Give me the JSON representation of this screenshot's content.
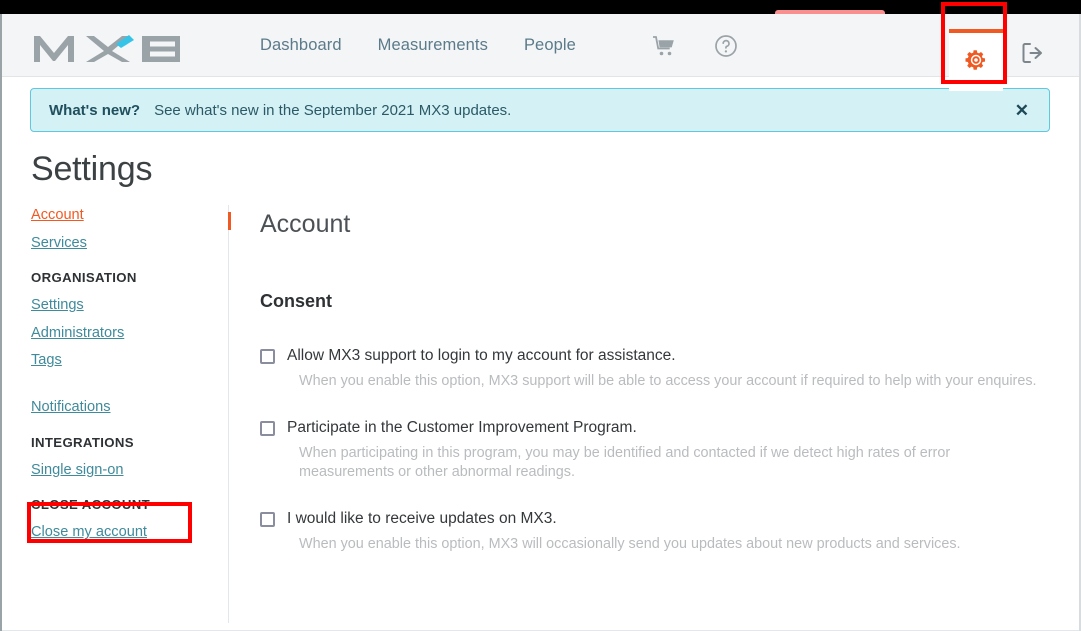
{
  "header": {
    "logo_text": "MX3",
    "logo_color": "#9aa3a8",
    "logo_accent_color": "#35c4e8",
    "nav": [
      {
        "label": "Dashboard",
        "name": "nav-dashboard"
      },
      {
        "label": "Measurements",
        "name": "nav-measurements"
      },
      {
        "label": "People",
        "name": "nav-people"
      }
    ],
    "icons": {
      "cart": "cart-icon",
      "help": "help-circle-icon",
      "settings": "gear-icon",
      "logout": "logout-icon"
    },
    "settings_active": true,
    "accent_color": "#f05a22"
  },
  "banner": {
    "strong": "What's new?",
    "text": "See what's new in the September 2021 MX3 updates.",
    "close_label": "✕",
    "background": "#d4f1f5",
    "border_color": "#5ec8dd"
  },
  "page": {
    "title": "Settings"
  },
  "sidebar": {
    "items": [
      {
        "label": "Account",
        "active": true
      },
      {
        "label": "Services",
        "active": false
      }
    ],
    "groups": [
      {
        "heading": "ORGANISATION",
        "items": [
          {
            "label": "Settings"
          },
          {
            "label": "Administrators"
          },
          {
            "label": "Tags"
          }
        ]
      }
    ],
    "notifications": {
      "label": "Notifications"
    },
    "integrations": {
      "heading": "INTEGRATIONS",
      "items": [
        {
          "label": "Single sign-on",
          "highlighted": true
        }
      ]
    },
    "close_account": {
      "heading": "CLOSE ACCOUNT",
      "items": [
        {
          "label": "Close my account"
        }
      ]
    },
    "link_color": "#3f8a9b",
    "active_color": "#f05a22"
  },
  "main": {
    "title": "Account",
    "section_title": "Consent",
    "consents": [
      {
        "label": "Allow MX3 support to login to my account for assistance.",
        "description": "When you enable this option, MX3 support will be able to access your account if required to help with your enquires.",
        "checked": false
      },
      {
        "label": "Participate in the Customer Improvement Program.",
        "description": "When participating in this program, you may be identified and contacted if we detect high rates of error measurements or other abnormal readings.",
        "checked": false
      },
      {
        "label": "I would like to receive updates on MX3.",
        "description": "When you enable this option, MX3 will occasionally send you updates about new products and services.",
        "checked": false
      }
    ]
  },
  "annotations": {
    "color": "#ff0000",
    "boxes": [
      {
        "name": "annotation-gear-icon",
        "target": "gear-icon"
      },
      {
        "name": "annotation-single-sign-on",
        "target": "sidebar-item-single-sign-on"
      }
    ]
  }
}
